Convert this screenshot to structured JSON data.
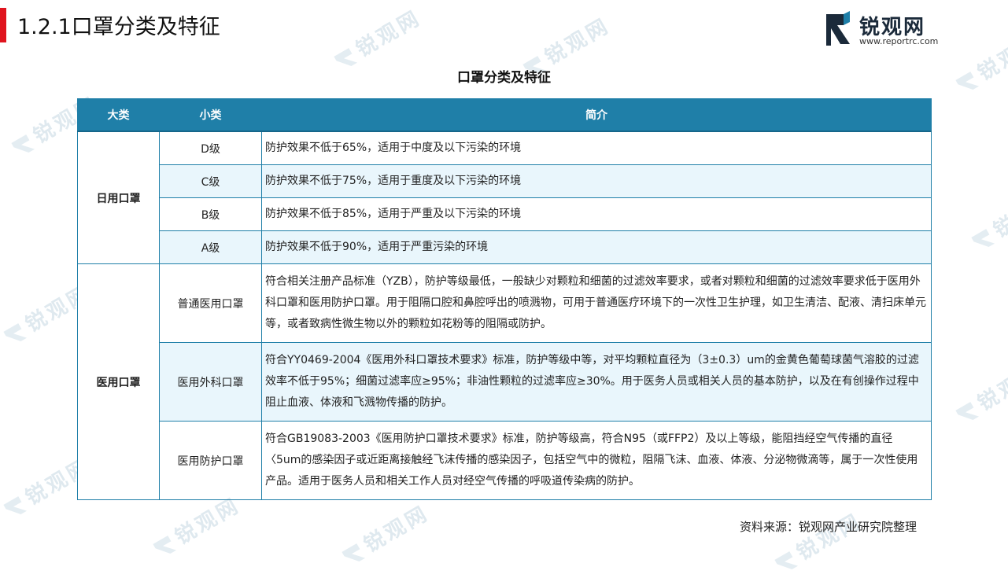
{
  "page": {
    "title": "1.2.1口罩分类及特征"
  },
  "logo": {
    "name": "锐观网",
    "url": "www.reportrc.com"
  },
  "table": {
    "title": "口罩分类及特征",
    "headers": [
      "大类",
      "小类",
      "简介"
    ],
    "groups": [
      {
        "category": "日用口罩",
        "rows": [
          {
            "sub": "D级",
            "desc": "防护效果不低于65%，适用于中度及以下污染的环境"
          },
          {
            "sub": "C级",
            "desc": "防护效果不低于75%，适用于重度及以下污染的环境"
          },
          {
            "sub": "B级",
            "desc": "防护效果不低于85%，适用于严重及以下污染的环境"
          },
          {
            "sub": "A级",
            "desc": "防护效果不低于90%，适用于严重污染的环境"
          }
        ]
      },
      {
        "category": "医用口罩",
        "rows": [
          {
            "sub": "普通医用口罩",
            "desc": "符合相关注册产品标准（YZB），防护等级最低，一般缺少对颗粒和细菌的过滤效率要求，或者对颗粒和细菌的过滤效率要求低于医用外科口罩和医用防护口罩。用于阻隔口腔和鼻腔呼出的喷溅物，可用于普通医疗环境下的一次性卫生护理，如卫生清洁、配液、清扫床单元等，或者致病性微生物以外的颗粒如花粉等的阻隔或防护。"
          },
          {
            "sub": "医用外科口罩",
            "desc": "符合YY0469-2004《医用外科口罩技术要求》标准，防护等级中等，对平均颗粒直径为（3±0.3）um的金黄色葡萄球菌气溶胶的过滤效率不低于95%；细菌过滤率应≥95%；非油性颗粒的过滤率应≥30%。用于医务人员或相关人员的基本防护，以及在有创操作过程中阻止血液、体液和飞溅物传播的防护。"
          },
          {
            "sub": "医用防护口罩",
            "desc": "符合GB19083-2003《医用防护口罩技术要求》标准，防护等级高，符合N95（或FFP2）及以上等级，能阻挡经空气传播的直径〈5um的感染因子或近距离接触经飞沫传播的感染因子，包括空气中的微粒，阻隔飞沫、血液、体液、分泌物微滴等，属于一次性使用产品。适用于医务人员和相关工作人员对经空气传播的呼吸道传染病的防护。"
          }
        ]
      }
    ]
  },
  "source": "资料来源：锐观网产业研究院整理",
  "colors": {
    "accent": "#e0141e",
    "header": "#1f7fa8",
    "stripe": "#e9f6fc"
  }
}
